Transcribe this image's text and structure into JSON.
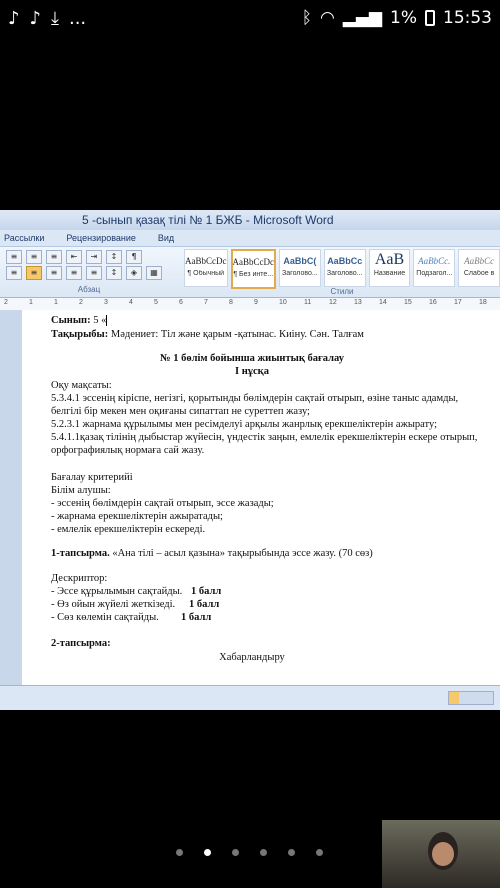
{
  "status_bar": {
    "left_icons": [
      "tiktok-icon",
      "tiktok-icon",
      "download-icon",
      "more-icon"
    ],
    "more_text": "...",
    "battery": "1%",
    "time": "15:53"
  },
  "word": {
    "title": "5 -сынып қазақ тілі  № 1 БЖБ - Microsoft Word",
    "menus": [
      "Рассылки",
      "Рецензирование",
      "Вид"
    ],
    "paragraph_group_label": "Абзац",
    "styles_group_label": "Стили",
    "styles": [
      {
        "sample": "AaBbCcDc",
        "name": "¶ Обычный"
      },
      {
        "sample": "AaBbCcDc",
        "name": "¶ Без инте..."
      },
      {
        "sample": "AaBbC(",
        "name": "Заголово..."
      },
      {
        "sample": "AaBbCc",
        "name": "Заголово..."
      },
      {
        "sample": "AaB",
        "name": "Название"
      },
      {
        "sample": "AaBbCc.",
        "name": "Подзагол..."
      },
      {
        "sample": "AaBbCc",
        "name": "Слабое в"
      }
    ],
    "ruler_numbers": [
      "2",
      "1",
      "1",
      "2",
      "3",
      "4",
      "5",
      "6",
      "7",
      "8",
      "9",
      "10",
      "11",
      "12",
      "13",
      "14",
      "15",
      "16",
      "17",
      "18"
    ]
  },
  "document": {
    "class_label": "Сынып:",
    "class_value": " 5 «",
    "topic_label": "Тақырыбы:",
    "topic_value": " Мәдениет: Тіл және қарым -қатынас. Киіну. Сән. Талғам",
    "heading1": "№ 1 бөлім бойынша жиынтық бағалау",
    "heading2": "I нұсқа",
    "goals_title": "Оқу мақсаты:",
    "goals": [
      "5.3.4.1  эссенің  кіріспе,  негізгі,  қорытынды  бөлімдерін  сақтай  отырып,  өзіне  таныс  адамды,",
      "белгілі бір мекен мен оқиғаны  сипаттап не суреттеп жазу;",
      "5.2.3.1 жарнама құрылымы мен ресімделуі арқылы жанрлық ерекшеліктерін ажырату;",
      "5.4.1.1қазақ тілінің дыбыстар жүйесін, үндестік заңын, емлелік ерекшеліктерін ескере отырып,",
      "орфографиялық нормаға сай жазу."
    ],
    "criteria_title": "Бағалау критерийі",
    "learner_label": "Білім алушы:",
    "criteria": [
      "- эссенің бөлімдерін сақтай отырып, эссе жазады;",
      "- жарнама ерекшеліктерін ажыратады;",
      "- емлелік ерекшеліктерін ескереді."
    ],
    "task1_label": "1-тапсырма.",
    "task1_text": "  «Ана тілі – асыл қазына» тақырыбында эссе жазу. (70 сөз)",
    "descriptor_title": "Дескриптор:",
    "descriptors": [
      {
        "text": "- Эссе құрылымын сақтайды.",
        "score": "1 балл"
      },
      {
        "text": "- Өз ойын жүйелі жеткізеді.",
        "score": "1 балл"
      },
      {
        "text": "- Сөз көлемін сақтайды.",
        "score": "1 балл"
      }
    ],
    "task2_label": "2-тапсырма:",
    "announcement": "Хабарландыру"
  },
  "carousel": {
    "count": 6,
    "active": 1
  }
}
